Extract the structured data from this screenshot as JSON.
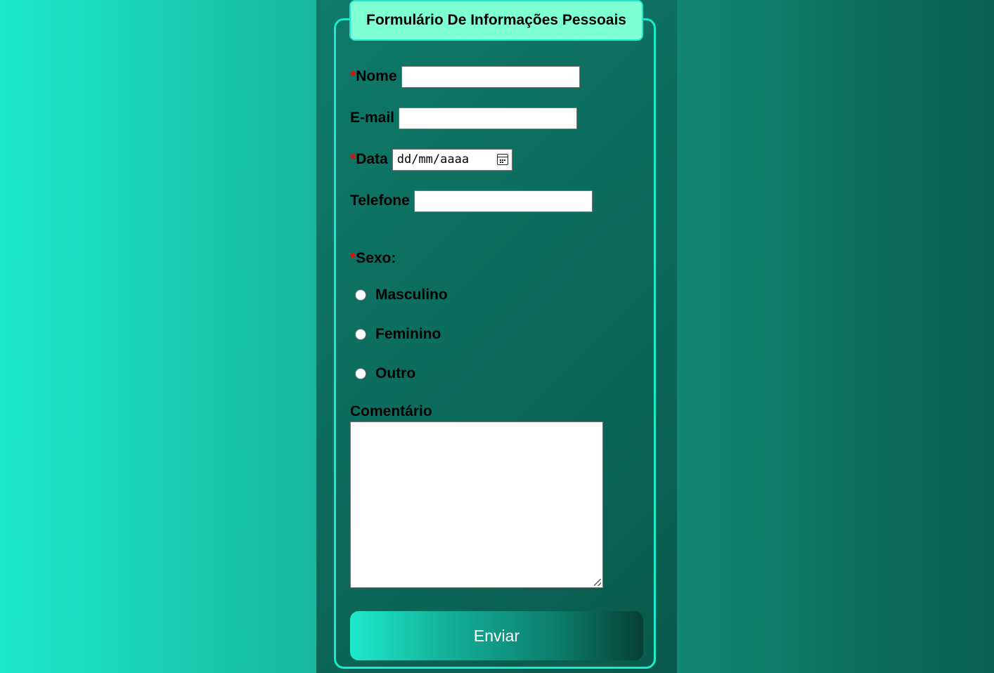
{
  "form": {
    "title": "Formulário De Informações Pessoais",
    "required_mark": "*",
    "fields": {
      "nome": {
        "label": "Nome",
        "value": ""
      },
      "email": {
        "label": "E-mail",
        "value": ""
      },
      "data": {
        "label": "Data",
        "placeholder": "dd/mm/aaaa"
      },
      "telefone": {
        "label": "Telefone",
        "value": ""
      }
    },
    "sexo": {
      "label": "Sexo:",
      "options": [
        "Masculino",
        "Feminino",
        "Outro"
      ]
    },
    "comentario": {
      "label": "Comentário",
      "value": ""
    },
    "submit_label": "Enviar"
  },
  "colors": {
    "accent": "#1de9cc",
    "legend_bg": "#7fffd4",
    "required": "#ff0000"
  }
}
